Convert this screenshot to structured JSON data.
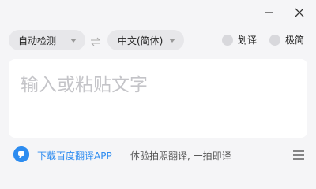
{
  "window": {
    "controls": [
      {
        "name": "minimize",
        "icon": "minimize-icon"
      },
      {
        "name": "close",
        "icon": "close-icon"
      }
    ]
  },
  "toolbar": {
    "source_language": "自动检测",
    "target_language": "中文(简体)",
    "swap_icon": "swap-arrows-icon",
    "toggles": [
      {
        "label": "划译",
        "on": false
      },
      {
        "label": "极简",
        "on": false
      }
    ]
  },
  "input": {
    "placeholder": "输入或粘贴文字",
    "value": ""
  },
  "footer": {
    "app_link": "下载百度翻译APP",
    "promo_text": "体验拍照翻译, 一拍即译",
    "menu_icon": "hamburger-menu-icon"
  },
  "colors": {
    "accent": "#2d8cf0",
    "background": "#f5f5f7",
    "pill_bg": "#e7e7ea",
    "toggle_off": "#d8d8dc",
    "placeholder": "#c4c4c8"
  }
}
